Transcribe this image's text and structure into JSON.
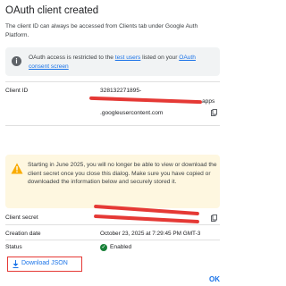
{
  "dialog": {
    "title": "OAuth client created",
    "subtitle": "The client ID can always be accessed from Clients tab under Google Auth Platform."
  },
  "info": {
    "text_before": "OAuth access is restricted to the ",
    "link1": "test users",
    "text_mid": " listed on your ",
    "link2": "OAuth consent screen"
  },
  "client_id": {
    "label": "Client ID",
    "value_start": "328132271895-",
    "value_tail": "apps",
    "value_line2": ".googleusercontent.com"
  },
  "warning": {
    "text": "Starting in June 2025, you will no longer be able to view or download the client secret once you close this dialog. Make sure you have copied or downloaded the information below and securely stored it."
  },
  "client_secret": {
    "label": "Client secret"
  },
  "creation_date": {
    "label": "Creation date",
    "value": "October 23, 2025 at 7:29:45 PM GMT-3"
  },
  "status": {
    "label": "Status",
    "value": "Enabled"
  },
  "actions": {
    "download": "Download JSON",
    "ok": "OK"
  },
  "colors": {
    "accent": "#1a73e8",
    "redaction": "#e53935",
    "warning_bg": "#fef7e0",
    "info_bg": "#f1f3f4",
    "success": "#188038"
  },
  "icons": {
    "info": "info-icon",
    "warning": "warning-icon",
    "copy": "copy-icon",
    "download": "download-icon",
    "check": "check-circle-icon"
  }
}
